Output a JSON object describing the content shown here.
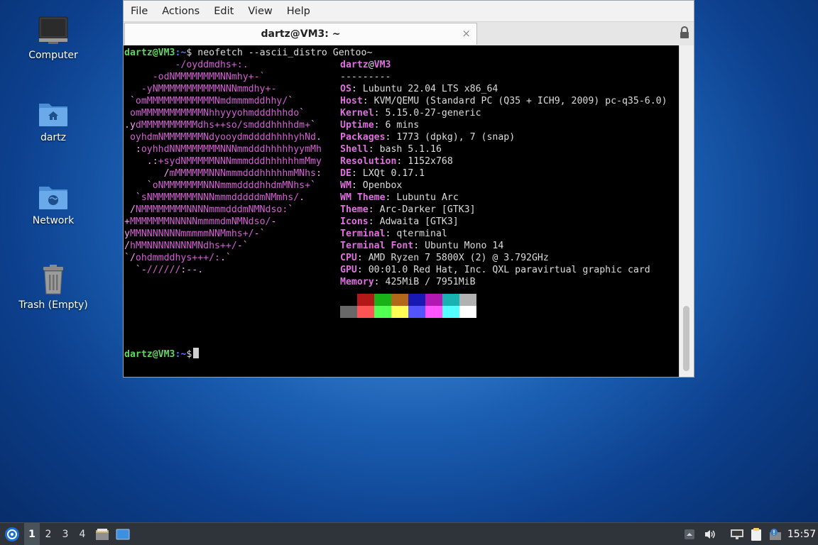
{
  "desktop": {
    "icons": [
      {
        "label": "Computer"
      },
      {
        "label": "dartz"
      },
      {
        "label": "Network"
      },
      {
        "label": "Trash (Empty)"
      }
    ]
  },
  "window": {
    "menu": [
      "File",
      "Actions",
      "Edit",
      "View",
      "Help"
    ],
    "tab_title": "dartz@VM3: ~",
    "tab_close": "×"
  },
  "terminal": {
    "prompt_user": "dartz@VM3",
    "prompt_path": ":~",
    "prompt_symbol": "$",
    "command": " neofetch --ascii_distro Gentoo~",
    "ascii_art": [
      [
        "         ",
        "-/oyddmdhs+:.",
        ""
      ],
      [
        "     ",
        "-odNMMMMMMMMNNmhy+-`",
        ""
      ],
      [
        "   ",
        "-yNMMMMMMMMMMMNNNmmdhy+-",
        ""
      ],
      [
        " `",
        "omMMMMMMMMMMMMNmdmmmmddhhy/",
        "`"
      ],
      [
        " ",
        "omMMMMMMMMMMMNhhyyyohmdddhhhdo",
        "`"
      ],
      [
        ".y",
        "dMMMMMMMMMMdhs++so/smdddhhhhdm+",
        "`"
      ],
      [
        " ",
        "oyhdmNMMMMMMMNdyooydmddddhhhhyhNd",
        "."
      ],
      [
        "  :",
        "oyhhdNNMMMMMMMNNNmmdddhhhhhyymMh",
        ""
      ],
      [
        "    .:",
        "+sydNMMMMMNNNmmmdddhhhhhhmMmy",
        ""
      ],
      [
        "       /",
        "mMMMMMMNNNmmmdddhhhhhmMNhs",
        ":"
      ],
      [
        "    `",
        "oNMMMMMMMNNNmmmddddhhdmMNhs+",
        "`"
      ],
      [
        "  `",
        "sNMMMMMMMMNNNmmmdddddmNMmhs/",
        "."
      ],
      [
        " /",
        "NMMMMMMMMNNNNmmmdddmNMNdso:",
        "`"
      ],
      [
        "+",
        "MMMMMMMNNNNNmmmmdmNMNdso/",
        "-"
      ],
      [
        "y",
        "MMNNNNNNNmmmmmNNMmhs+/",
        "-`"
      ],
      [
        "/",
        "hMMNNNNNNNNMNdhs++/",
        "-`"
      ],
      [
        "`/",
        "ohdmmddhys+++/:",
        ".`"
      ],
      [
        "  `-",
        "//////",
        ":--."
      ]
    ],
    "info_user": "dartz",
    "info_at": "@",
    "info_host": "VM3",
    "separator": "---------",
    "info": [
      {
        "key": "OS",
        "value": "Lubuntu 22.04 LTS x86_64"
      },
      {
        "key": "Host",
        "value": "KVM/QEMU (Standard PC (Q35 + ICH9, 2009) pc-q35-6.0)"
      },
      {
        "key": "Kernel",
        "value": "5.15.0-27-generic"
      },
      {
        "key": "Uptime",
        "value": "6 mins"
      },
      {
        "key": "Packages",
        "value": "1773 (dpkg), 7 (snap)"
      },
      {
        "key": "Shell",
        "value": "bash 5.1.16"
      },
      {
        "key": "Resolution",
        "value": "1152x768"
      },
      {
        "key": "DE",
        "value": "LXQt 0.17.1"
      },
      {
        "key": "WM",
        "value": "Openbox"
      },
      {
        "key": "WM Theme",
        "value": "Lubuntu Arc"
      },
      {
        "key": "Theme",
        "value": "Arc-Darker [GTK3]"
      },
      {
        "key": "Icons",
        "value": "Adwaita [GTK3]"
      },
      {
        "key": "Terminal",
        "value": "qterminal"
      },
      {
        "key": "Terminal Font",
        "value": "Ubuntu Mono 14"
      },
      {
        "key": "CPU",
        "value": "AMD Ryzen 7 5800X (2) @ 3.792GHz"
      },
      {
        "key": "GPU",
        "value": "00:01.0 Red Hat, Inc. QXL paravirtual graphic card"
      },
      {
        "key": "Memory",
        "value": "425MiB / 7951MiB"
      }
    ],
    "palette_top": [
      "#000000",
      "#b21818",
      "#18b218",
      "#b26818",
      "#1818b2",
      "#b218b2",
      "#18b2b2",
      "#b2b2b2"
    ],
    "palette_bottom": [
      "#686868",
      "#ff5454",
      "#54ff54",
      "#ffff54",
      "#5454ff",
      "#ff54ff",
      "#54ffff",
      "#ffffff"
    ]
  },
  "taskbar": {
    "workspaces": [
      "1",
      "2",
      "3",
      "4"
    ],
    "active_workspace": "1",
    "clock": "15:57"
  }
}
